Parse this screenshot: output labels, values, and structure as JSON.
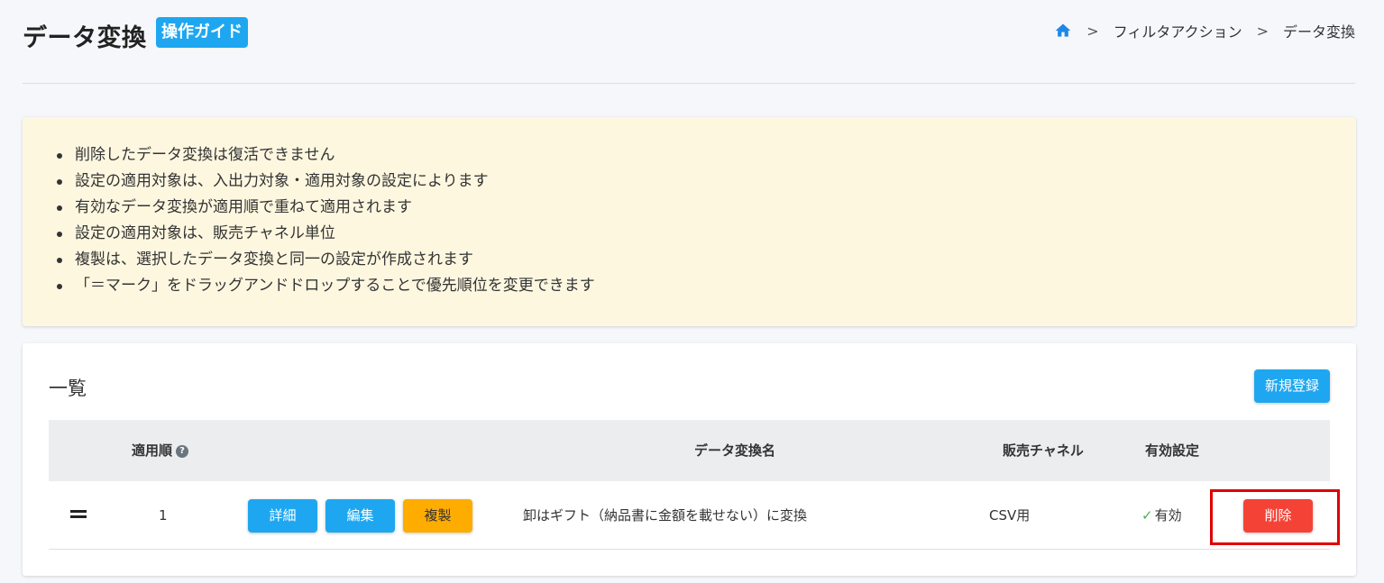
{
  "header": {
    "title": "データ変換",
    "guide_label": "操作ガイド",
    "breadcrumb": [
      "フィルタアクション",
      "データ変換"
    ]
  },
  "notice": {
    "items": [
      "削除したデータ変換は復活できません",
      "設定の適用対象は、入出力対象・適用対象の設定によります",
      "有効なデータ変換が適用順で重ねて適用されます",
      "設定の適用対象は、販売チャネル単位",
      "複製は、選択したデータ変換と同一の設定が作成されます",
      "「＝マーク」をドラッグアンドドロップすることで優先順位を変更できます"
    ]
  },
  "list": {
    "title": "一覧",
    "new_label": "新規登録",
    "columns": {
      "order": "適用順",
      "name": "データ変換名",
      "channel": "販売チャネル",
      "enabled": "有効設定"
    },
    "help_glyph": "?",
    "rows": [
      {
        "order": "1",
        "detail_label": "詳細",
        "edit_label": "編集",
        "copy_label": "複製",
        "name": "卸はギフト（納品書に金額を載せない）に変換",
        "channel": "CSV用",
        "check_glyph": "✓",
        "enabled": "有効",
        "delete_label": "削除"
      }
    ]
  },
  "colors": {
    "primary": "#1ea7f0",
    "warning": "#ffac00",
    "danger": "#f44336",
    "highlight": "#e00000"
  }
}
